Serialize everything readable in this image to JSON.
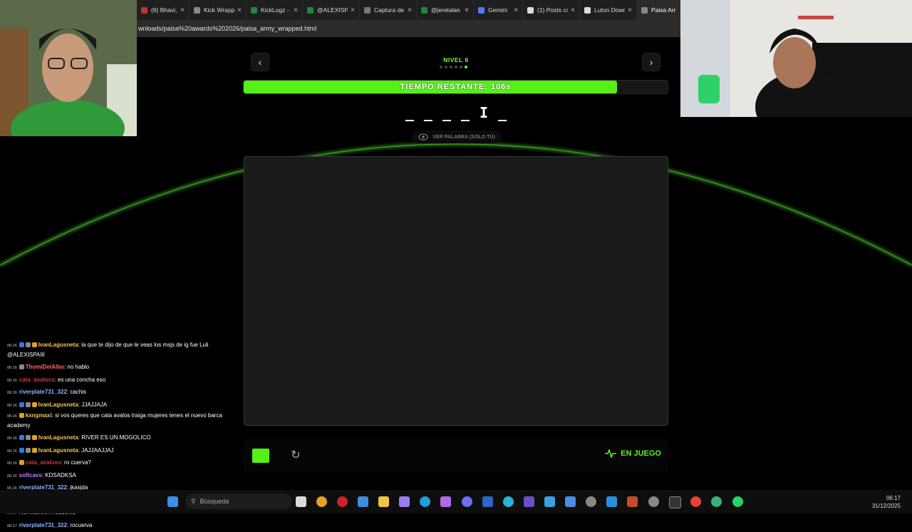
{
  "browser": {
    "tabs": [
      {
        "label": "(6) Bhavi, Se",
        "color": "#c4302b"
      },
      {
        "label": "Kick Wrapp",
        "color": "#888888"
      },
      {
        "label": "KickLogz - /",
        "color": "#1d8a3a"
      },
      {
        "label": "@ALEXISPA",
        "color": "#1d8a3a"
      },
      {
        "label": "Captura de",
        "color": "#777777"
      },
      {
        "label": "@jerelalan",
        "color": "#1d8a3a"
      },
      {
        "label": "Gemini",
        "color": "#4f7cff"
      },
      {
        "label": "(1) Posts co",
        "color": "#dddddd"
      },
      {
        "label": "Luton Down",
        "color": "#dddddd"
      },
      {
        "label": "Paisa Arm",
        "color": "#888888"
      }
    ],
    "address": "wnloads/paisa%20awards%202026/paisa_army_wrapped.html"
  },
  "game": {
    "level_label": "NIVEL 6",
    "level_total": 6,
    "level_current": 6,
    "timer_text": "TIEMPO RESTANTE: 106s",
    "timer_fraction": 0.88,
    "word_slots": [
      "_",
      "_",
      "_",
      "_",
      "I",
      "_"
    ],
    "reveal_label": "VER PALABRA (SOLO TÚ)",
    "status_label": "EN JUEGO",
    "brush_color": "#55f018",
    "accent": "#55f018"
  },
  "chat": [
    {
      "time": "06:16",
      "user": "IvanLagusneta",
      "color": "#f2c75c",
      "text": ": la que te dijo de que le veas los msjs de ig fue Luli @ALEXISPAIII",
      "badges": [
        "#2f7bd8",
        "#8a8a8a",
        "#e0a020"
      ]
    },
    {
      "time": "06:16",
      "user": "ThomiDelAlbo",
      "color": "#f56b6b",
      "text": ": no hablo",
      "badges": [
        "#8a8a8a"
      ]
    },
    {
      "time": "06:16",
      "user": "cata_avaloss",
      "color": "#d23a3a",
      "text": ": es una concha eso",
      "badges": []
    },
    {
      "time": "06:16",
      "user": "riverplate731_322",
      "color": "#8fb4ff",
      "text": ": cachis",
      "badges": []
    },
    {
      "time": "06:16",
      "user": "IvanLagusneta",
      "color": "#f2c75c",
      "text": ": JJAJJAJA",
      "badges": [
        "#2f7bd8",
        "#8a8a8a",
        "#e0a020"
      ]
    },
    {
      "time": "06:16",
      "user": "kxngmaxi",
      "color": "#f2c75c",
      "text": ": si vos queres que cata avalos traiga mujeres tenes el nuevo barca academy",
      "badges": [
        "#e0a020"
      ]
    },
    {
      "time": "06:16",
      "user": "IvanLagusneta",
      "color": "#f2c75c",
      "text": ": RIVER ES UN MOGOLICO",
      "badges": [
        "#2f7bd8",
        "#8a8a8a",
        "#e0a020"
      ]
    },
    {
      "time": "06:16",
      "user": "IvanLagusneta",
      "color": "#f2c75c",
      "text": ": JAJJAAJJAJ",
      "badges": [
        "#2f7bd8",
        "#8a8a8a",
        "#e0a020"
      ]
    },
    {
      "time": "06:16",
      "user": "cata_avaloss",
      "color": "#d23a3a",
      "text": ": ro cuerva?",
      "badges": [
        "#e0a020"
      ]
    },
    {
      "time": "06:16",
      "user": "soficavs",
      "color": "#c77dff",
      "text": ": KDSADKSA",
      "badges": []
    },
    {
      "time": "06:16",
      "user": "riverplate731_322",
      "color": "#8fb4ff",
      "text": ": jkasjda",
      "badges": []
    },
    {
      "time": "06:17",
      "user": "soficavs",
      "color": "#c77dff",
      "text": ": h",
      "badges": []
    },
    {
      "time": "06:17",
      "user": "Hermano07",
      "color": "#8fb4ff",
      "text": ": rocuerva",
      "badges": []
    },
    {
      "time": "06:17",
      "user": "riverplate731_322",
      "color": "#8fb4ff",
      "text": ": rocuerva",
      "badges": []
    }
  ],
  "taskbar": {
    "search_placeholder": "Búsqueda",
    "time": "06:17",
    "date": "31/12/2025"
  }
}
